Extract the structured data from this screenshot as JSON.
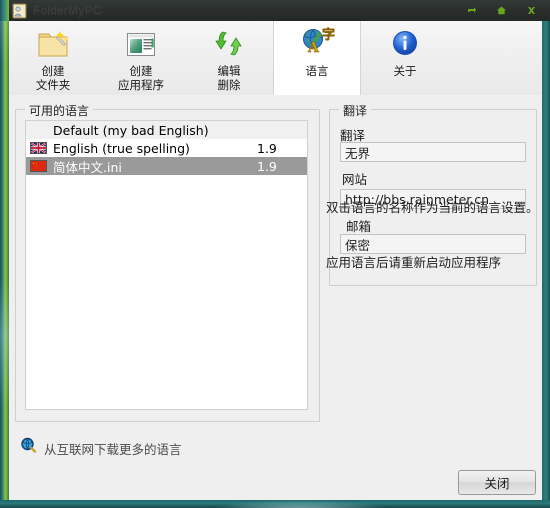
{
  "window": {
    "title": "FolderMyPC",
    "app_icon": "folder-person-icon",
    "controls": [
      {
        "name": "restore-button",
        "glyph": "restore-icon"
      },
      {
        "name": "minimize-button",
        "glyph": "home-icon"
      },
      {
        "name": "close-button",
        "glyph": "close-icon"
      }
    ]
  },
  "toolbar": {
    "items": [
      {
        "icon": "folder-wand-icon",
        "line1": "创建",
        "line2": "文件夹",
        "active": false
      },
      {
        "icon": "application-window-icon",
        "line1": "创建",
        "line2": "应用程序",
        "active": false
      },
      {
        "icon": "green-arrows-icon",
        "line1": "编辑",
        "line2": "删除",
        "active": false
      },
      {
        "icon": "globe-language-icon",
        "line1": "语言",
        "line2": "",
        "active": true
      },
      {
        "icon": "info-circle-icon",
        "line1": "关于",
        "line2": "",
        "active": false
      }
    ]
  },
  "languages_group": {
    "title": "可用的语言",
    "rows": [
      {
        "flag": "none",
        "name": "Default (my bad English)",
        "version": "",
        "style": "alt"
      },
      {
        "flag": "uk-flag-icon",
        "name": "English (true spelling)",
        "version": "1.9",
        "style": "normal"
      },
      {
        "flag": "china-flag-icon",
        "name": "简体中文.ini",
        "version": "1.9",
        "style": "selected"
      }
    ]
  },
  "translation_group": {
    "title": "翻译",
    "fields": [
      {
        "label": "翻译",
        "value": "无界",
        "name": "translator-field"
      },
      {
        "label": "网站",
        "value": "http://bbs.rainmeter.cn",
        "name": "website-field"
      },
      {
        "label": "邮箱",
        "value": "保密",
        "name": "email-field"
      }
    ]
  },
  "hints": {
    "line1": "双击语言的名称作为当前的语言设置。",
    "line2": "应用语言后请重新启动应用程序"
  },
  "download_link": {
    "icon": "magnifier-globe-icon",
    "text": "从互联网下载更多的语言"
  },
  "footer": {
    "close_label": "关闭"
  },
  "colors": {
    "frame_green": "#8cc63f",
    "frame_teal": "#2b7f80",
    "selection_gray": "#9a9a9a",
    "content_bg": "#efefef",
    "active_tab_bg": "#ffffff"
  }
}
